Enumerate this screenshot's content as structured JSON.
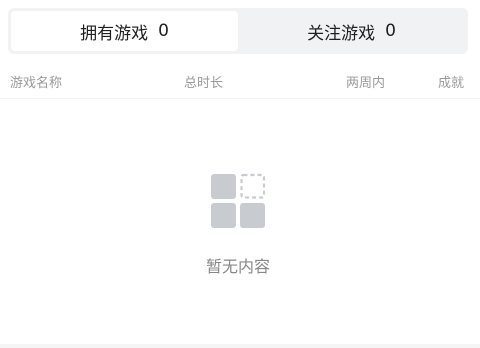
{
  "tabs": [
    {
      "label": "拥有游戏",
      "count": "0",
      "active": true
    },
    {
      "label": "关注游戏",
      "count": "0",
      "active": false
    }
  ],
  "columns": {
    "name": "游戏名称",
    "total_time": "总时长",
    "two_weeks": "两周内",
    "achievements": "成就"
  },
  "empty_state": {
    "icon": "empty-grid-icon",
    "text": "暂无内容"
  },
  "colors": {
    "tab_bar_bg": "#f1f2f4",
    "header_text": "#9a9a9a",
    "icon_gray": "#c8cbd0"
  }
}
